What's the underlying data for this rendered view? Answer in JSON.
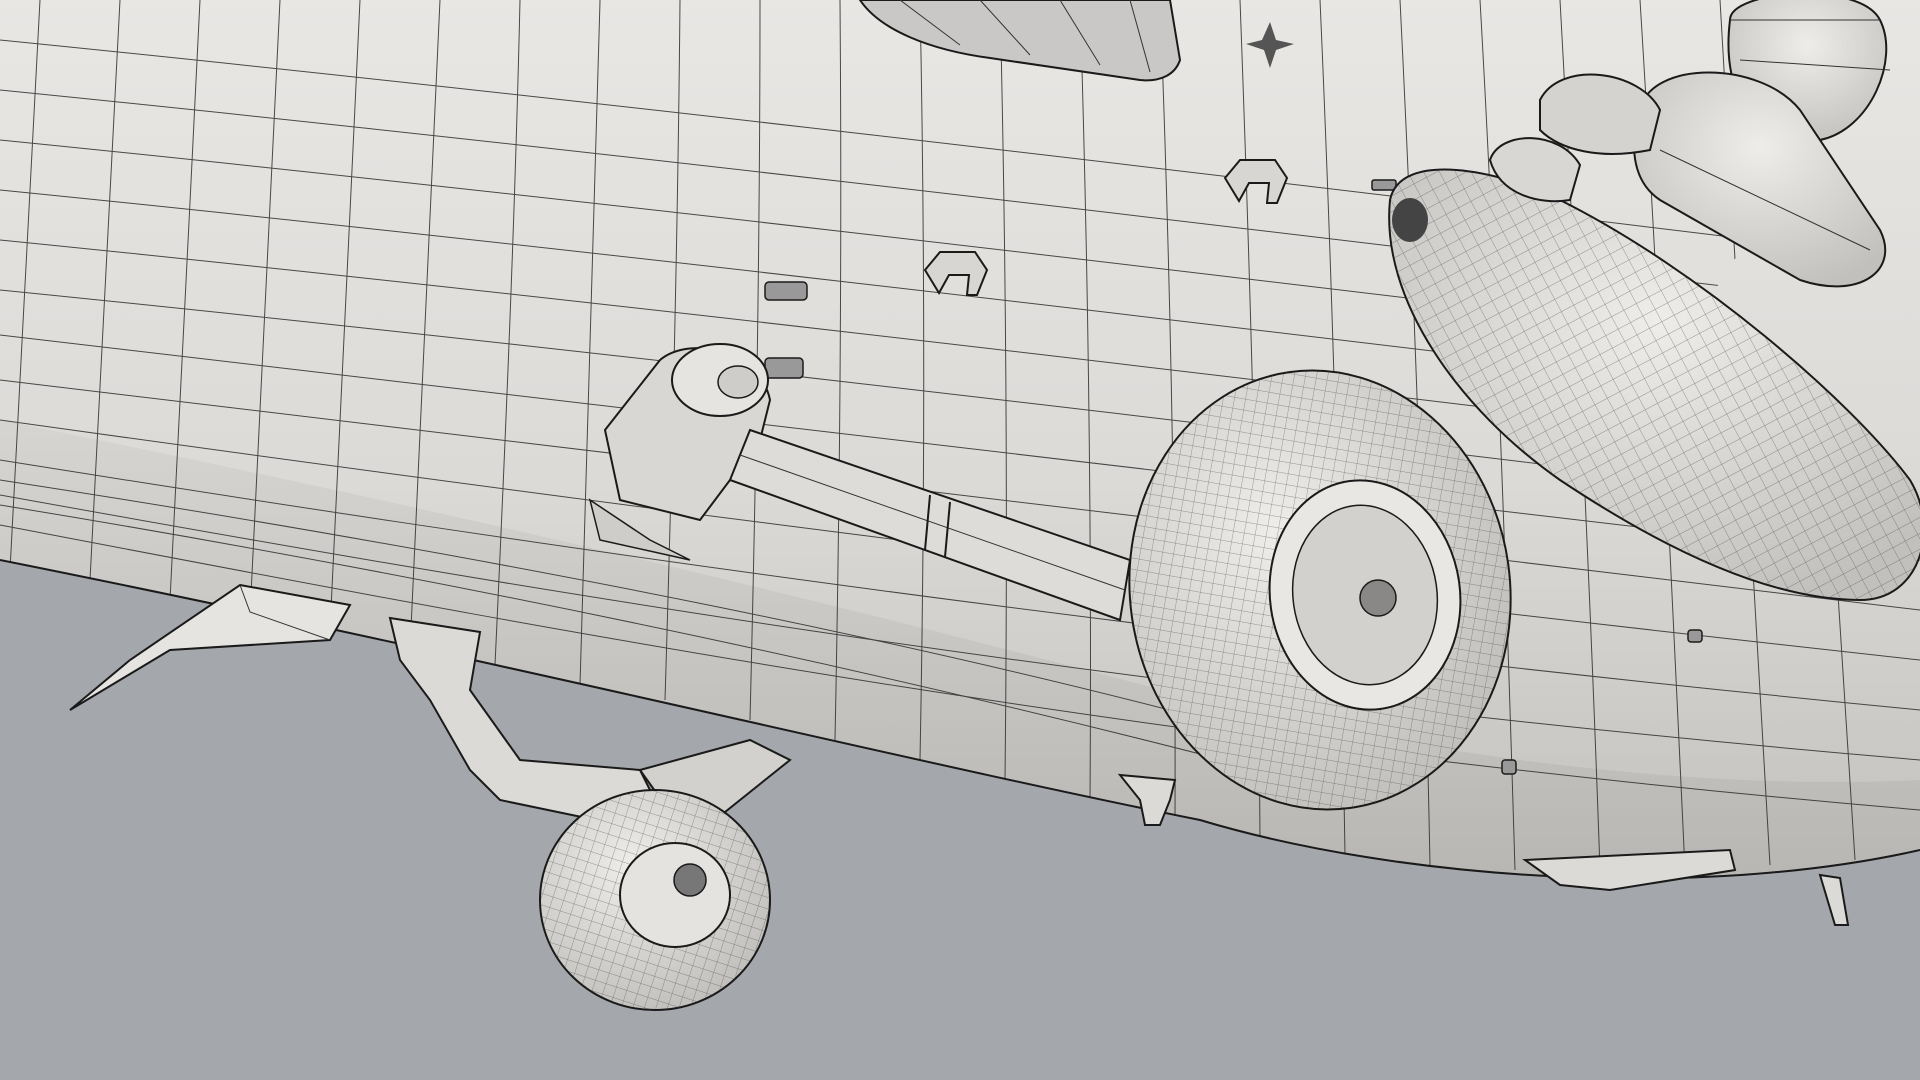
{
  "scene": {
    "subject": "helicopter-underside-wireframe",
    "background_color": "#a4a7ab",
    "surface_light": "#e6e4e1",
    "surface_mid": "#cfcdca",
    "surface_dark": "#b3b1ae",
    "wire_color": "#2b2b2b",
    "outline_color": "#1a1a1a"
  }
}
